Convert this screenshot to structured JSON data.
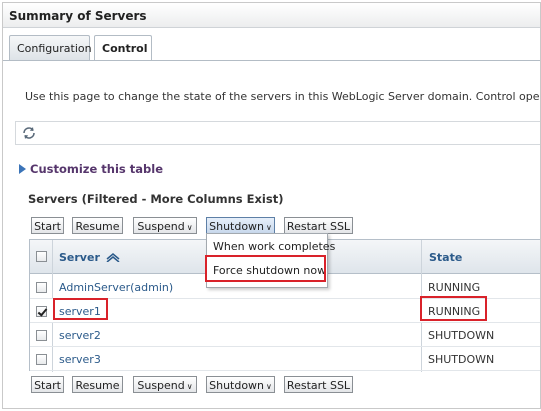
{
  "panel": {
    "title": "Summary of Servers"
  },
  "tabs": [
    {
      "label": "Configuration",
      "active": false
    },
    {
      "label": "Control",
      "active": true
    }
  ],
  "intro": "Use this page to change the state of the servers in this WebLogic Server domain. Control operations on M",
  "icons": {
    "refresh": "refresh-icon",
    "customize": "expand-triangle-icon",
    "sort": "sort-ascending-icon"
  },
  "customize_label": "Customize this table",
  "table_caption": "Servers (Filtered - More Columns Exist)",
  "buttons": {
    "start": "Start",
    "resume": "Resume",
    "suspend": "Suspend",
    "shutdown": "Shutdown",
    "restart_ssl": "Restart SSL"
  },
  "shutdown_menu": [
    "When work completes",
    "Force shutdown now"
  ],
  "table": {
    "headers": {
      "server": "Server",
      "state": "State"
    },
    "rows": [
      {
        "server": "AdminServer(admin)",
        "state": "RUNNING",
        "checked": false
      },
      {
        "server": "server1",
        "state": "RUNNING",
        "checked": true
      },
      {
        "server": "server2",
        "state": "SHUTDOWN",
        "checked": false
      },
      {
        "server": "server3",
        "state": "SHUTDOWN",
        "checked": false
      }
    ]
  },
  "colors": {
    "link": "#2b5a8a",
    "highlight": "#d9222a",
    "customize": "#56366c"
  }
}
